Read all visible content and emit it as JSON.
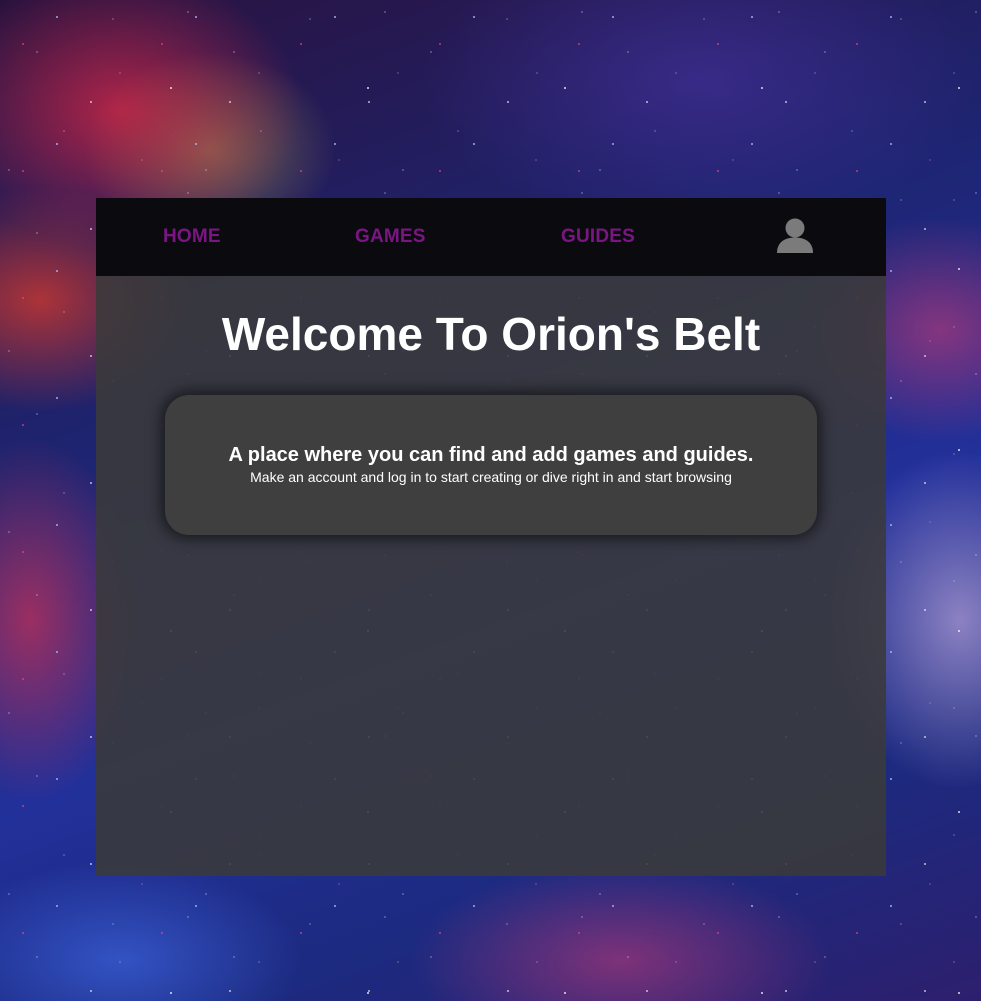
{
  "nav": {
    "home_label": "HOME",
    "games_label": "GAMES",
    "guides_label": "GUIDES",
    "user_icon": "user-profile-icon",
    "link_color": "#7a1583"
  },
  "main": {
    "title": "Welcome To Orion's Belt",
    "card": {
      "headline": "A place where you can find and add games and guides.",
      "subtext": "Make an account and log in to start creating or dive right in and start browsing"
    }
  },
  "colors": {
    "panel": "#3a3a3a",
    "navbar": "#08080c",
    "card": "#3f3f3f",
    "text": "#ffffff"
  }
}
